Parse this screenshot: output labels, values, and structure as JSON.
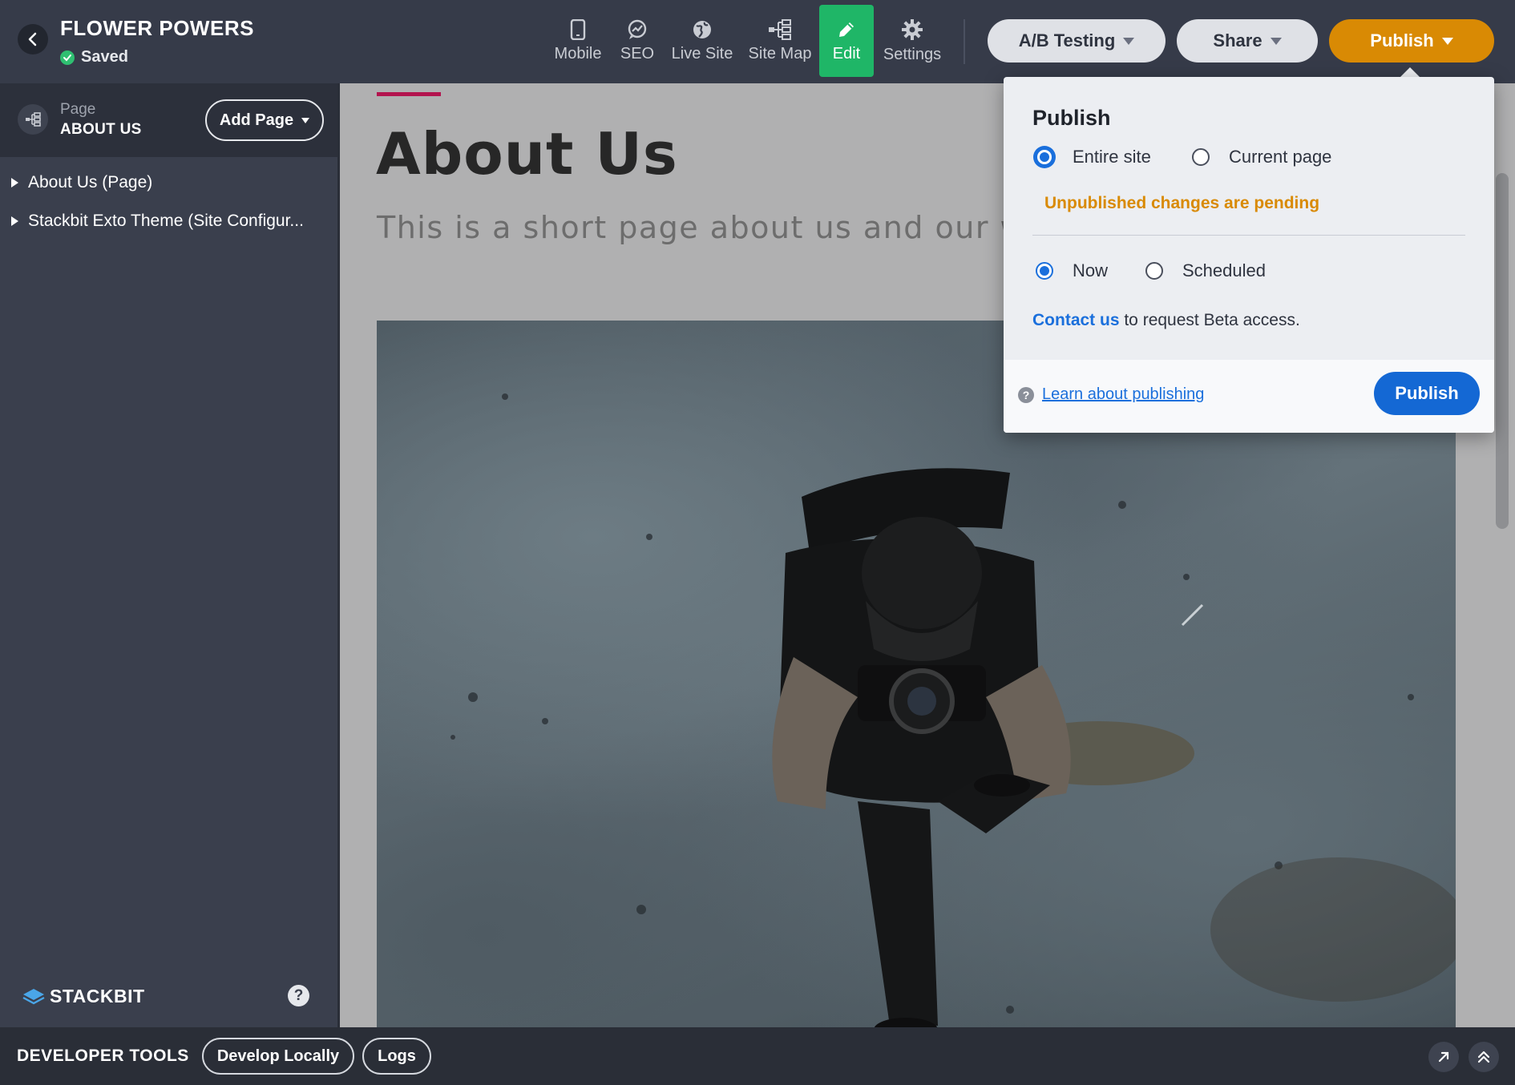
{
  "header": {
    "site_title": "FLOWER POWERS",
    "save_status": "Saved",
    "tools": [
      {
        "label": "Mobile",
        "icon": "mobile-icon"
      },
      {
        "label": "SEO",
        "icon": "seo-icon"
      },
      {
        "label": "Live Site",
        "icon": "globe-icon"
      },
      {
        "label": "Site Map",
        "icon": "sitemap-icon"
      },
      {
        "label": "Edit",
        "icon": "pencil-icon",
        "active": true
      },
      {
        "label": "Settings",
        "icon": "gear-icon"
      }
    ],
    "ab_testing_label": "A/B Testing",
    "share_label": "Share",
    "publish_label": "Publish"
  },
  "sidebar": {
    "page_kicker": "Page",
    "page_name": "ABOUT US",
    "add_page_label": "Add Page",
    "tree": [
      {
        "label": "About Us (Page)"
      },
      {
        "label": "Stackbit Exto Theme (Site Configur..."
      }
    ],
    "brand": "STACKBIT",
    "help": "?"
  },
  "preview": {
    "heading": "About Us",
    "subheading": "This is a short page about us and our wo",
    "hero_alt": "Photographer with camera viewed from above on concrete floor"
  },
  "publish_popover": {
    "title": "Publish",
    "scope_options": [
      {
        "label": "Entire site",
        "selected": true
      },
      {
        "label": "Current page",
        "selected": false
      }
    ],
    "pending_text": "Unpublished changes are pending",
    "timing_options": [
      {
        "label": "Now",
        "selected": true
      },
      {
        "label": "Scheduled",
        "selected": false
      }
    ],
    "contact_link": "Contact us",
    "contact_rest": " to request Beta access.",
    "help_glyph": "?",
    "learn_link": "Learn about publishing",
    "publish_button": "Publish"
  },
  "devtools": {
    "label": "DEVELOPER TOOLS",
    "develop_locally": "Develop Locally",
    "logs": "Logs"
  },
  "colors": {
    "topbar": "#363b49",
    "edit_active": "#1fb667",
    "publish_orange": "#d98a04",
    "link_blue": "#1a6fdc",
    "pending_orange": "#d98a04",
    "accent_line": "#b3134e"
  }
}
